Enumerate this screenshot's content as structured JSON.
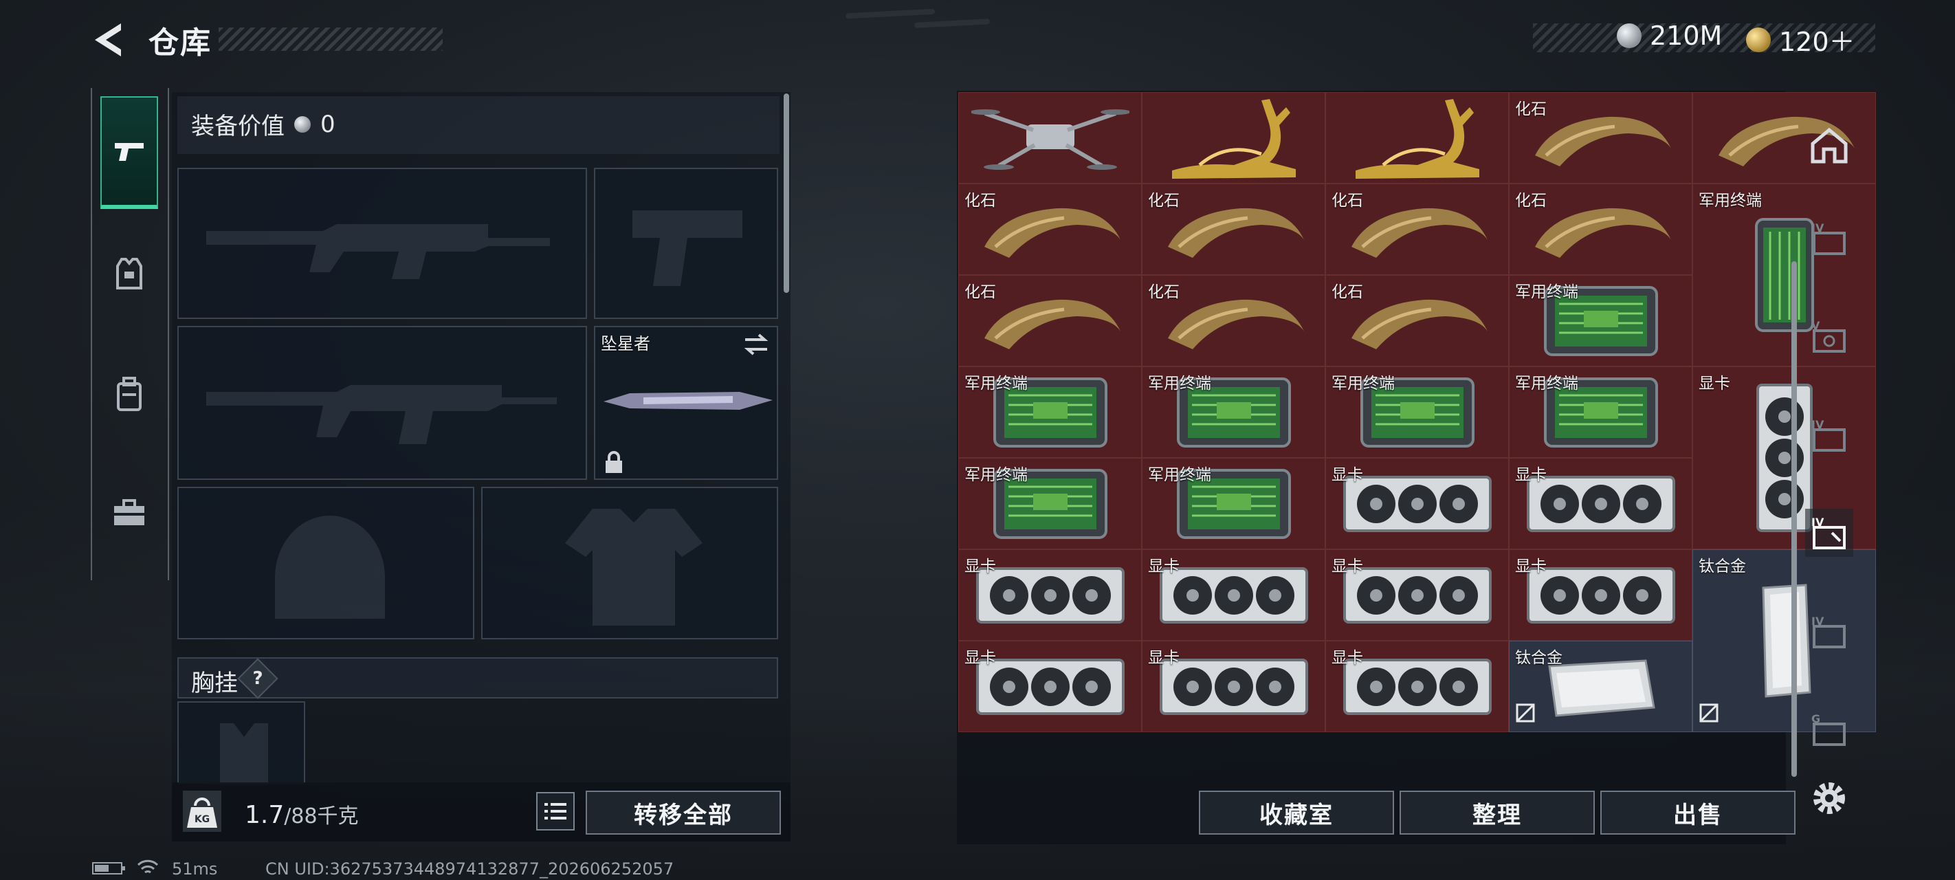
{
  "header": {
    "title": "仓库",
    "currency_silver": "210M",
    "currency_gold": "120＋"
  },
  "equipment": {
    "value_label": "装备价值",
    "value": "0",
    "melee_label": "坠星者",
    "chest_label": "胸挂",
    "help_label": "?"
  },
  "footer": {
    "weight_current": "1.7",
    "weight_max": "/88千克",
    "kg_badge": "KG",
    "transfer_all": "转移全部",
    "collection": "收藏室",
    "organize": "整理",
    "sell": "出售"
  },
  "grid": {
    "items": [
      {
        "label": "",
        "icon": "drone-icon"
      },
      {
        "label": "",
        "icon": "golden-deer-icon"
      },
      {
        "label": "",
        "icon": "golden-deer-icon"
      },
      {
        "label": "化石",
        "icon": "fossil-claw-icon"
      },
      {
        "label": "",
        "icon": "fossil-claw-icon"
      },
      {
        "label": "化石",
        "icon": "fossil-claw-icon"
      },
      {
        "label": "化石",
        "icon": "fossil-claw-icon"
      },
      {
        "label": "化石",
        "icon": "fossil-claw-icon"
      },
      {
        "label": "化石",
        "icon": "fossil-claw-icon"
      },
      {
        "label": "军用终端",
        "icon": "military-terminal-icon"
      },
      {
        "label": "化石",
        "icon": "fossil-claw-icon"
      },
      {
        "label": "化石",
        "icon": "fossil-claw-icon"
      },
      {
        "label": "化石",
        "icon": "fossil-claw-icon"
      },
      {
        "label": "军用终端",
        "icon": "military-terminal-icon"
      },
      {
        "label": "军用终端",
        "icon": "military-terminal-icon"
      },
      {
        "label": "军用终端",
        "icon": "military-terminal-icon"
      },
      {
        "label": "军用终端",
        "icon": "military-terminal-icon"
      },
      {
        "label": "军用终端",
        "icon": "military-terminal-icon"
      },
      {
        "label": "显卡",
        "icon": "graphics-card-icon"
      },
      {
        "label": "军用终端",
        "icon": "military-terminal-icon"
      },
      {
        "label": "军用终端",
        "icon": "military-terminal-icon"
      },
      {
        "label": "显卡",
        "icon": "graphics-card-icon"
      },
      {
        "label": "显卡",
        "icon": "graphics-card-icon"
      },
      {
        "label": "显卡",
        "icon": "graphics-card-icon"
      },
      {
        "label": "显卡",
        "icon": "graphics-card-icon"
      },
      {
        "label": "显卡",
        "icon": "graphics-card-icon"
      },
      {
        "label": "显卡",
        "icon": "graphics-card-icon"
      },
      {
        "label": "钛合金",
        "icon": "titanium-alloy-icon"
      },
      {
        "label": "显卡",
        "icon": "graphics-card-icon"
      },
      {
        "label": "显卡",
        "icon": "graphics-card-icon"
      },
      {
        "label": "显卡",
        "icon": "graphics-card-icon"
      },
      {
        "label": "钛合金",
        "icon": "titanium-alloy-icon"
      }
    ]
  },
  "status": {
    "ping": "51ms",
    "uid": "CN UID:362753734489741328​77_202606252057"
  },
  "colors": {
    "accent_green": "#3fd6a2",
    "cell_red": "#521e22",
    "cell_blue": "#2c3342"
  }
}
